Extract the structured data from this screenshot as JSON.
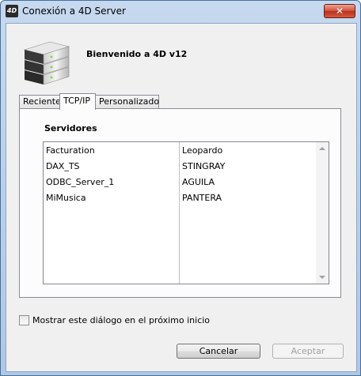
{
  "window": {
    "title": "Conexión a 4D Server",
    "app_icon_label": "4D",
    "close_glyph": "✕"
  },
  "header": {
    "welcome": "Bienvenido a 4D v12"
  },
  "tabs": [
    {
      "label": "Reciente",
      "active": false
    },
    {
      "label": "TCP/IP",
      "active": true
    },
    {
      "label": "Personalizado",
      "active": false
    }
  ],
  "servers": {
    "label": "Servidores",
    "rows": [
      {
        "name": "Facturation",
        "host": "Leopardo"
      },
      {
        "name": "DAX_TS",
        "host": "STINGRAY"
      },
      {
        "name": "ODBC_Server_1",
        "host": "AGUILA"
      },
      {
        "name": "MiMusica",
        "host": "PANTERA"
      }
    ]
  },
  "options": {
    "show_dialog_label": "Mostrar este diálogo en el próximo inicio",
    "show_dialog_checked": false
  },
  "buttons": {
    "cancel": "Cancelar",
    "accept": "Aceptar"
  }
}
